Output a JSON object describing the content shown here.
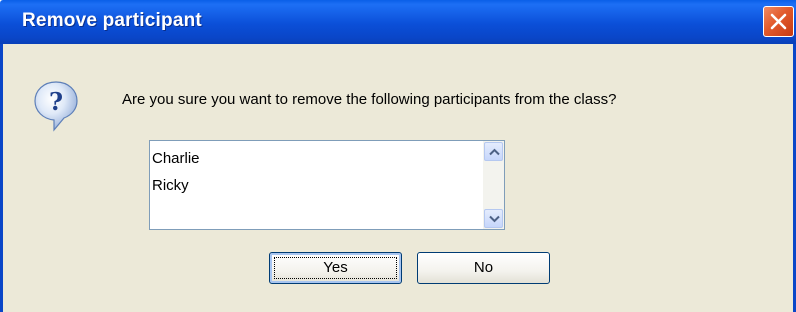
{
  "window": {
    "title": "Remove participant",
    "close_icon": "close-x-icon"
  },
  "dialog": {
    "icon": "question-icon",
    "message": "Are you sure you want to remove the following participants from the class?",
    "participants": [
      "Charlie",
      "Ricky"
    ]
  },
  "buttons": {
    "yes_label": "Yes",
    "no_label": "No"
  },
  "colors": {
    "titlebar": "#0a46c8",
    "body": "#ece9d8",
    "close": "#e25a2c"
  }
}
